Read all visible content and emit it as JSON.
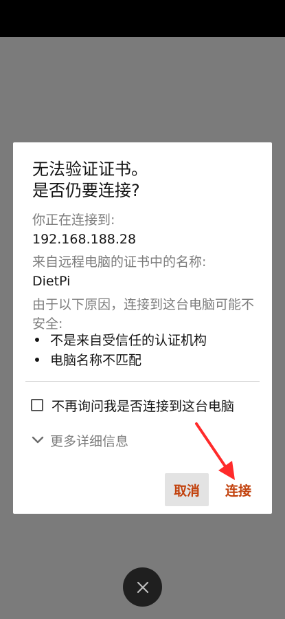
{
  "dialog": {
    "title_line1": "无法验证证书。",
    "title_line2": "是否仍要连接?",
    "connecting_to_label": "你正在连接到:",
    "host": "192.168.188.28",
    "cert_name_label": "来自远程电脑的证书中的名称:",
    "cert_name": "DietPi",
    "reason_intro": "由于以下原因，连接到这台电脑可能不安全:",
    "reasons": [
      "不是来自受信任的认证机构",
      "电脑名称不匹配"
    ],
    "dont_ask_label": "不再询问我是否连接到这台电脑",
    "dont_ask_checked": false,
    "more_details_label": "更多详细信息",
    "cancel_label": "取消",
    "connect_label": "连接"
  },
  "colors": {
    "accent": "#c2410c",
    "annotation_arrow": "#ff2a2a",
    "scrim": "#7b7b7b"
  },
  "icons": {
    "more_details": "chevron-down-icon",
    "fab": "close-icon",
    "annotation": "red-arrow-icon"
  }
}
